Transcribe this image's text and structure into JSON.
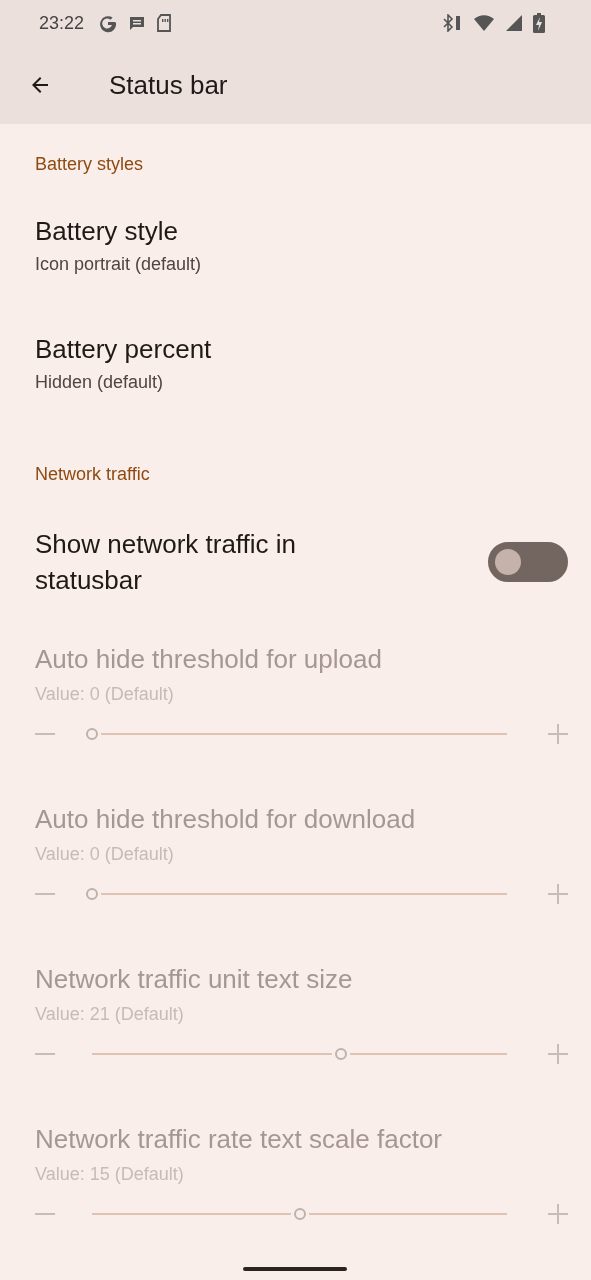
{
  "status_bar": {
    "time": "23:22"
  },
  "toolbar": {
    "title": "Status bar"
  },
  "items": [
    {
      "kind": "header",
      "title": "Battery styles"
    },
    {
      "kind": "text",
      "title": "Battery style",
      "summary": "Icon portrait (default)"
    },
    {
      "kind": "text",
      "title": "Battery percent",
      "summary": "Hidden (default)"
    },
    {
      "kind": "header",
      "title": "Network traffic"
    },
    {
      "kind": "switch",
      "title": "Show network traffic in statusbar",
      "on": false
    },
    {
      "kind": "slider",
      "title": "Auto hide threshold for upload",
      "summary": "Value: 0 (Default)",
      "level": 0,
      "disabled": true
    },
    {
      "kind": "slider",
      "title": "Auto hide threshold for download",
      "summary": "Value: 0 (Default)",
      "level": 0,
      "disabled": true
    },
    {
      "kind": "slider",
      "title": "Network traffic unit text size",
      "summary": "Value: 21 (Default)",
      "level": 0.6,
      "disabled": true
    },
    {
      "kind": "slider",
      "title": "Network traffic rate text scale factor",
      "summary": "Value: 15 (Default)",
      "level": 0.5,
      "disabled": true
    }
  ]
}
